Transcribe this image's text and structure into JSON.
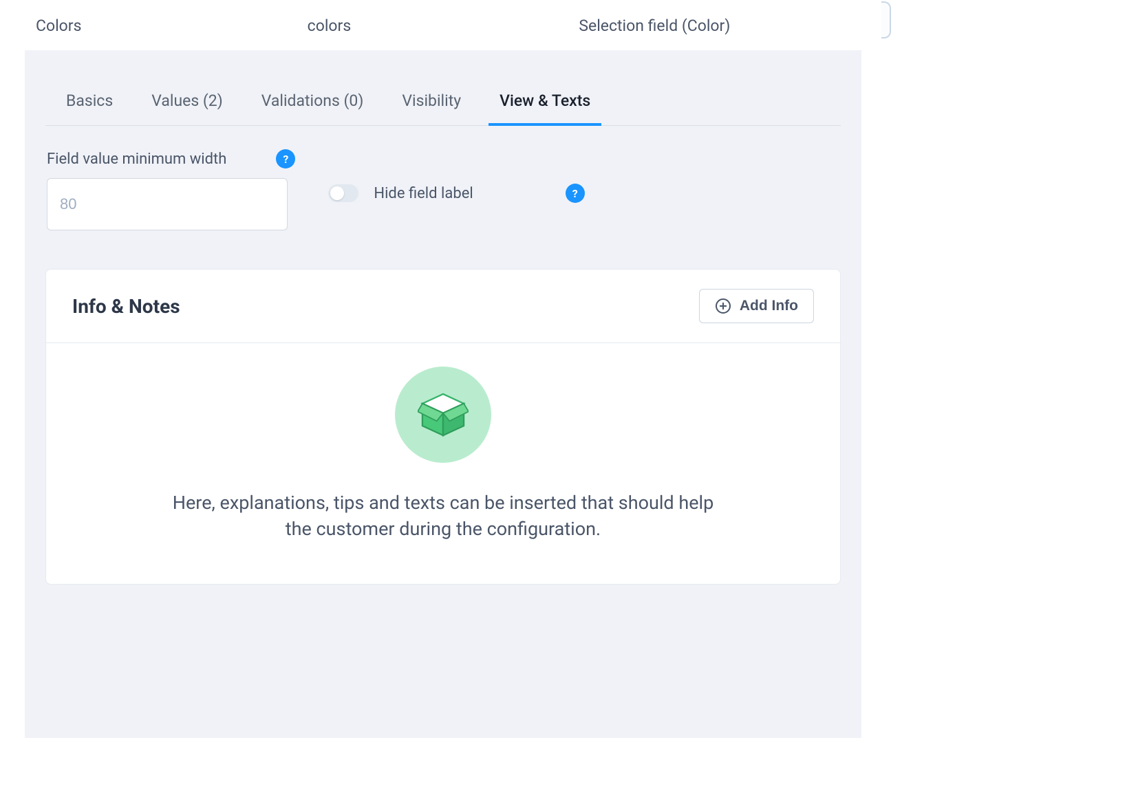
{
  "header": {
    "left": "Colors",
    "center": "colors",
    "right": "Selection field (Color)"
  },
  "tabs": {
    "basics": "Basics",
    "values": "Values (2)",
    "validations": "Validations (0)",
    "visibility": "Visibility",
    "view_texts": "View & Texts"
  },
  "form": {
    "min_width_label": "Field value minimum width",
    "min_width_placeholder": "80",
    "hide_label": "Hide field label"
  },
  "info_card": {
    "title": "Info & Notes",
    "add_button": "Add Info",
    "empty_text": "Here, explanations, tips and texts can be inserted that should help the customer during the configuration."
  }
}
